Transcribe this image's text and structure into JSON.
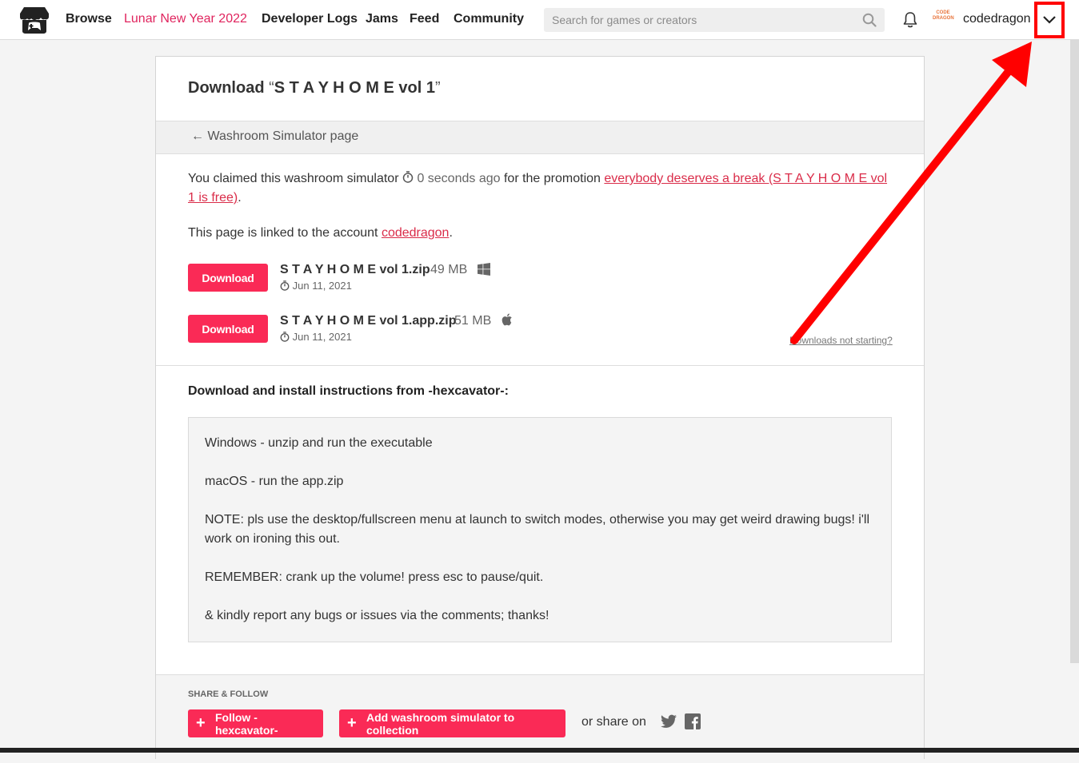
{
  "header": {
    "nav": [
      "Browse",
      "Lunar New Year 2022",
      "Developer Logs",
      "Jams",
      "Feed",
      "Community"
    ],
    "search_placeholder": "Search for games or creators",
    "avatar_text": "CODE DRAGON",
    "username": "codedragon"
  },
  "page": {
    "title_prefix": "Download",
    "title_open_quote": "“",
    "title_game": "S T A Y H O M E vol 1",
    "title_close_quote": "”",
    "back_link": "Washroom Simulator page",
    "claim_text_1": "You claimed this washroom simulator",
    "claim_time": "0 seconds ago",
    "claim_text_2": "for the promotion",
    "promo_link": "everybody deserves a break (S T A Y H O M E vol 1 is free)",
    "claim_end": ".",
    "linked_text": "This page is linked to the account",
    "linked_account": "codedragon",
    "linked_end": ".",
    "downloads_help": "Downloads not starting?"
  },
  "files": [
    {
      "button": "Download",
      "name": "S T A Y H O M E vol 1.zip",
      "size": "49 MB",
      "date": "Jun 11, 2021",
      "os_icon": "windows-icon"
    },
    {
      "button": "Download",
      "name": "S T A Y H O M E vol 1.app.zip",
      "size": "51 MB",
      "date": "Jun 11, 2021",
      "os_icon": "apple-icon"
    }
  ],
  "instructions": {
    "heading": "Download and install instructions from -hexcavator-:",
    "lines": [
      "Windows - unzip and run the executable",
      "macOS - run the app.zip",
      "NOTE: pls use the desktop/fullscreen menu at launch to switch modes, otherwise you may get weird drawing bugs! i'll work on ironing this out.",
      "REMEMBER: crank up the volume! press esc to pause/quit.",
      "& kindly report any bugs or issues via the comments; thanks!"
    ]
  },
  "share": {
    "title": "SHARE & FOLLOW",
    "follow_button": "Follow -hexcavator-",
    "collection_button": "Add washroom simulator to collection",
    "share_on": "or share on"
  },
  "colors": {
    "accent": "#fa2a56",
    "link": "#da2c49",
    "annotation": "#ff0000"
  }
}
